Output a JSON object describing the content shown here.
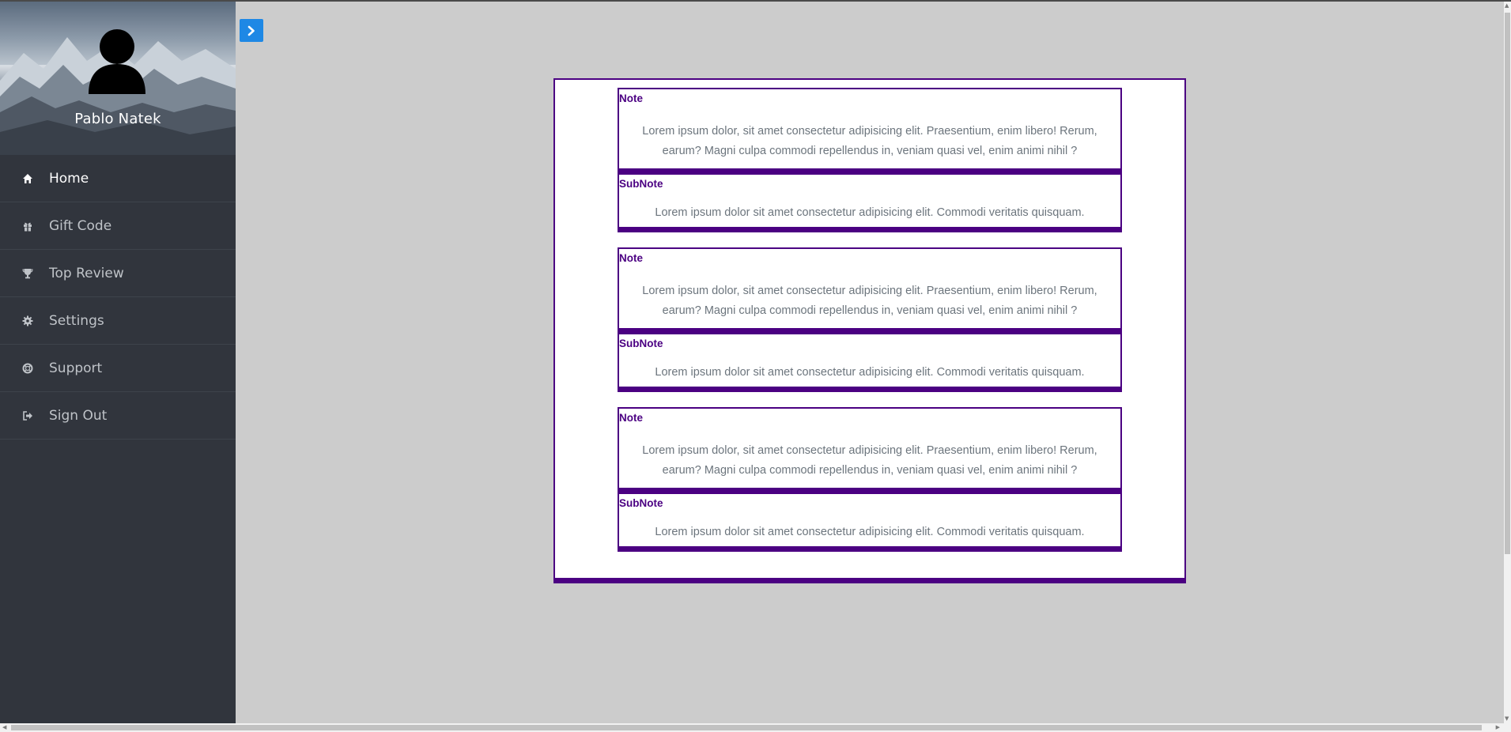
{
  "user": {
    "name": "Pablo Natek"
  },
  "nav": {
    "items": [
      {
        "label": "Home",
        "icon": "home-icon",
        "active": true
      },
      {
        "label": "Gift Code",
        "icon": "gift-icon",
        "active": false
      },
      {
        "label": "Top Review",
        "icon": "trophy-icon",
        "active": false
      },
      {
        "label": "Settings",
        "icon": "gear-icon",
        "active": false
      },
      {
        "label": "Support",
        "icon": "life-ring-icon",
        "active": false
      },
      {
        "label": "Sign Out",
        "icon": "sign-out-icon",
        "active": false
      }
    ]
  },
  "toggle": {
    "icon": "chevron-right-icon",
    "color": "#1e88e5"
  },
  "colors": {
    "accent": "#4b0082",
    "sidebar": "#31353d",
    "background": "#cccccc",
    "body_text": "#6c757d"
  },
  "notes": [
    {
      "note_label": "Note",
      "note_text": "Lorem ipsum dolor, sit amet consectetur adipisicing elit. Praesentium, enim libero! Rerum, earum? Magni culpa commodi repellendus in, veniam quasi vel, enim animi nihil ?",
      "subnote_label": "SubNote",
      "subnote_text": "Lorem ipsum dolor sit amet consectetur adipisicing elit. Commodi veritatis quisquam."
    },
    {
      "note_label": "Note",
      "note_text": "Lorem ipsum dolor, sit amet consectetur adipisicing elit. Praesentium, enim libero! Rerum, earum? Magni culpa commodi repellendus in, veniam quasi vel, enim animi nihil ?",
      "subnote_label": "SubNote",
      "subnote_text": "Lorem ipsum dolor sit amet consectetur adipisicing elit. Commodi veritatis quisquam."
    },
    {
      "note_label": "Note",
      "note_text": "Lorem ipsum dolor, sit amet consectetur adipisicing elit. Praesentium, enim libero! Rerum, earum? Magni culpa commodi repellendus in, veniam quasi vel, enim animi nihil ?",
      "subnote_label": "SubNote",
      "subnote_text": "Lorem ipsum dolor sit amet consectetur adipisicing elit. Commodi veritatis quisquam."
    }
  ]
}
